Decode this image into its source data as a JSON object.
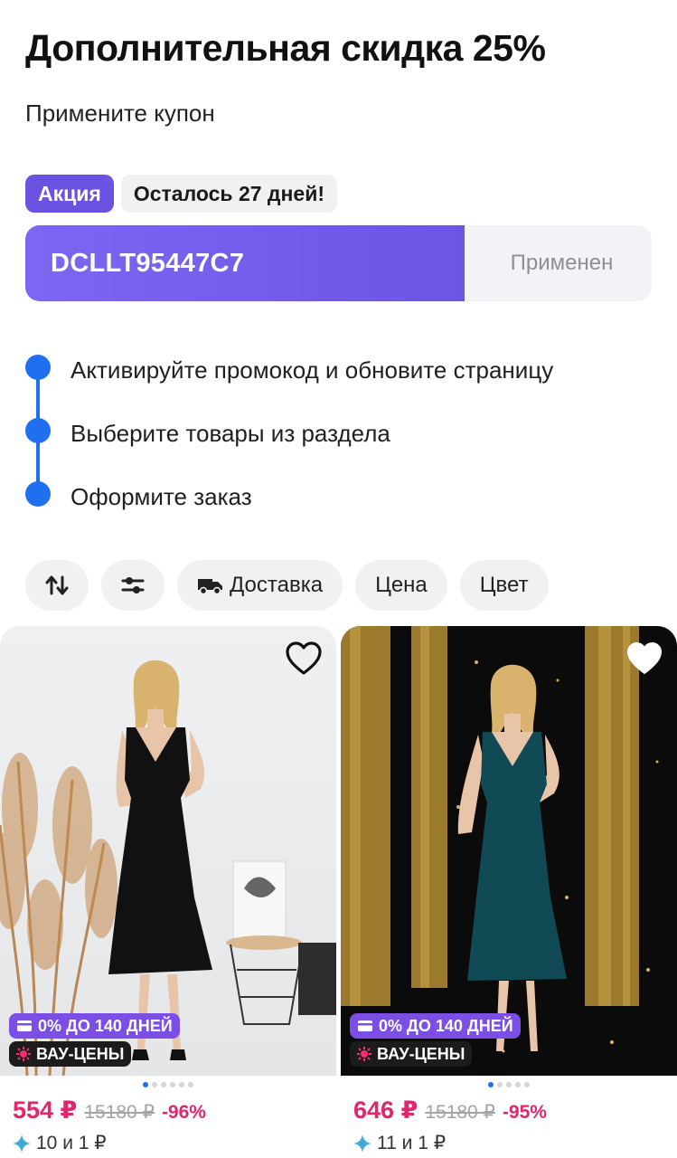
{
  "header": {
    "title": "Дополнительная скидка 25%",
    "subtitle": "Примените купон"
  },
  "badges": {
    "action": "Акция",
    "days_left": "Осталось 27 дней!"
  },
  "coupon": {
    "code": "DCLLT95447C7",
    "status": "Применен",
    "accent_color": "#6c55e3"
  },
  "steps": [
    "Активируйте промокод и обновите страницу",
    "Выберите товары из раздела",
    "Оформите заказ"
  ],
  "filters": {
    "sort_icon": "sort-arrows-icon",
    "settings_icon": "sliders-icon",
    "delivery": "Доставка",
    "price": "Цена",
    "color": "Цвет"
  },
  "products": [
    {
      "installment_tag": "0% ДО 140 ДНЕЙ",
      "wow_tag": "ВАУ-ЦЕНЫ",
      "price": "554 ₽",
      "old_price": "15180 ₽",
      "discount": "-96%",
      "bonus": "10 и 1 ₽",
      "dress_color": "#111111"
    },
    {
      "installment_tag": "0% ДО 140 ДНЕЙ",
      "wow_tag": "ВАУ-ЦЕНЫ",
      "price": "646 ₽",
      "old_price": "15180 ₽",
      "discount": "-95%",
      "bonus": "11 и 1 ₽",
      "dress_color": "#0f4a55"
    }
  ],
  "colors": {
    "step_blue": "#1f6ff0",
    "price_pink": "#e0266e",
    "purple_tag": "#7b4fe6"
  }
}
